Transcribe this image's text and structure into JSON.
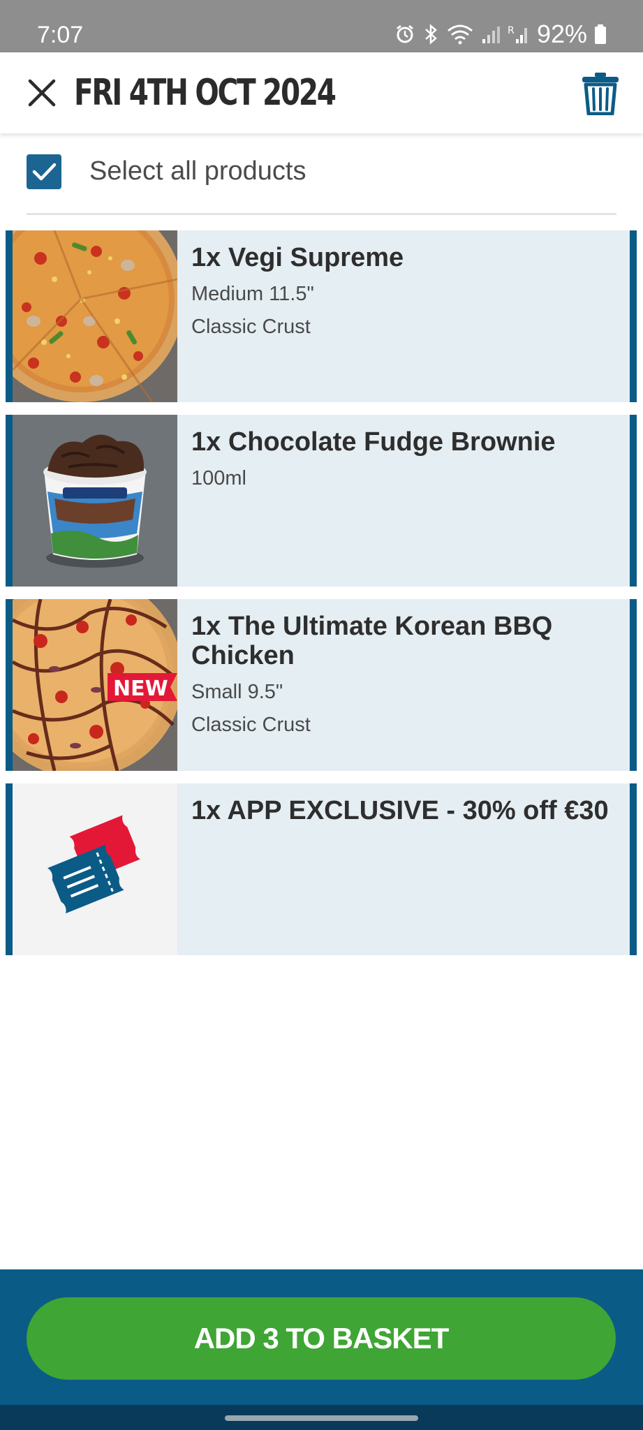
{
  "status_bar": {
    "time": "7:07",
    "battery": "92%",
    "icons": [
      "alarm-icon",
      "bluetooth-icon",
      "wifi-icon",
      "signal-icon",
      "signal-roaming-icon",
      "battery-icon"
    ]
  },
  "header": {
    "title": "FRI 4TH OCT 2024",
    "close_icon": "close-icon",
    "trash_icon": "trash-icon"
  },
  "select_all": {
    "label": "Select all products",
    "checked": true
  },
  "products": [
    {
      "name": "1x Vegi Supreme",
      "details": [
        "Medium 11.5\"",
        "Classic Crust"
      ],
      "image": "pizza-vegi-supreme"
    },
    {
      "name": "1x Chocolate Fudge Brownie",
      "details": [
        "100ml"
      ],
      "image": "ice-cream-tub"
    },
    {
      "name": "1x The Ultimate Korean BBQ Chicken",
      "details": [
        "Small 9.5\"",
        "Classic Crust"
      ],
      "image": "pizza-korean-bbq",
      "badge": "NEW"
    },
    {
      "name": "1x APP EXCLUSIVE - 30% off €30",
      "details": [],
      "image": "tickets-icon"
    }
  ],
  "add_button": {
    "label": "ADD 3 TO BASKET"
  },
  "colors": {
    "brand_blue": "#0b5b87",
    "checkbox_blue": "#1c6592",
    "add_green": "#3fa535",
    "row_bg": "#e5eef2",
    "badge_red": "#e31837"
  }
}
